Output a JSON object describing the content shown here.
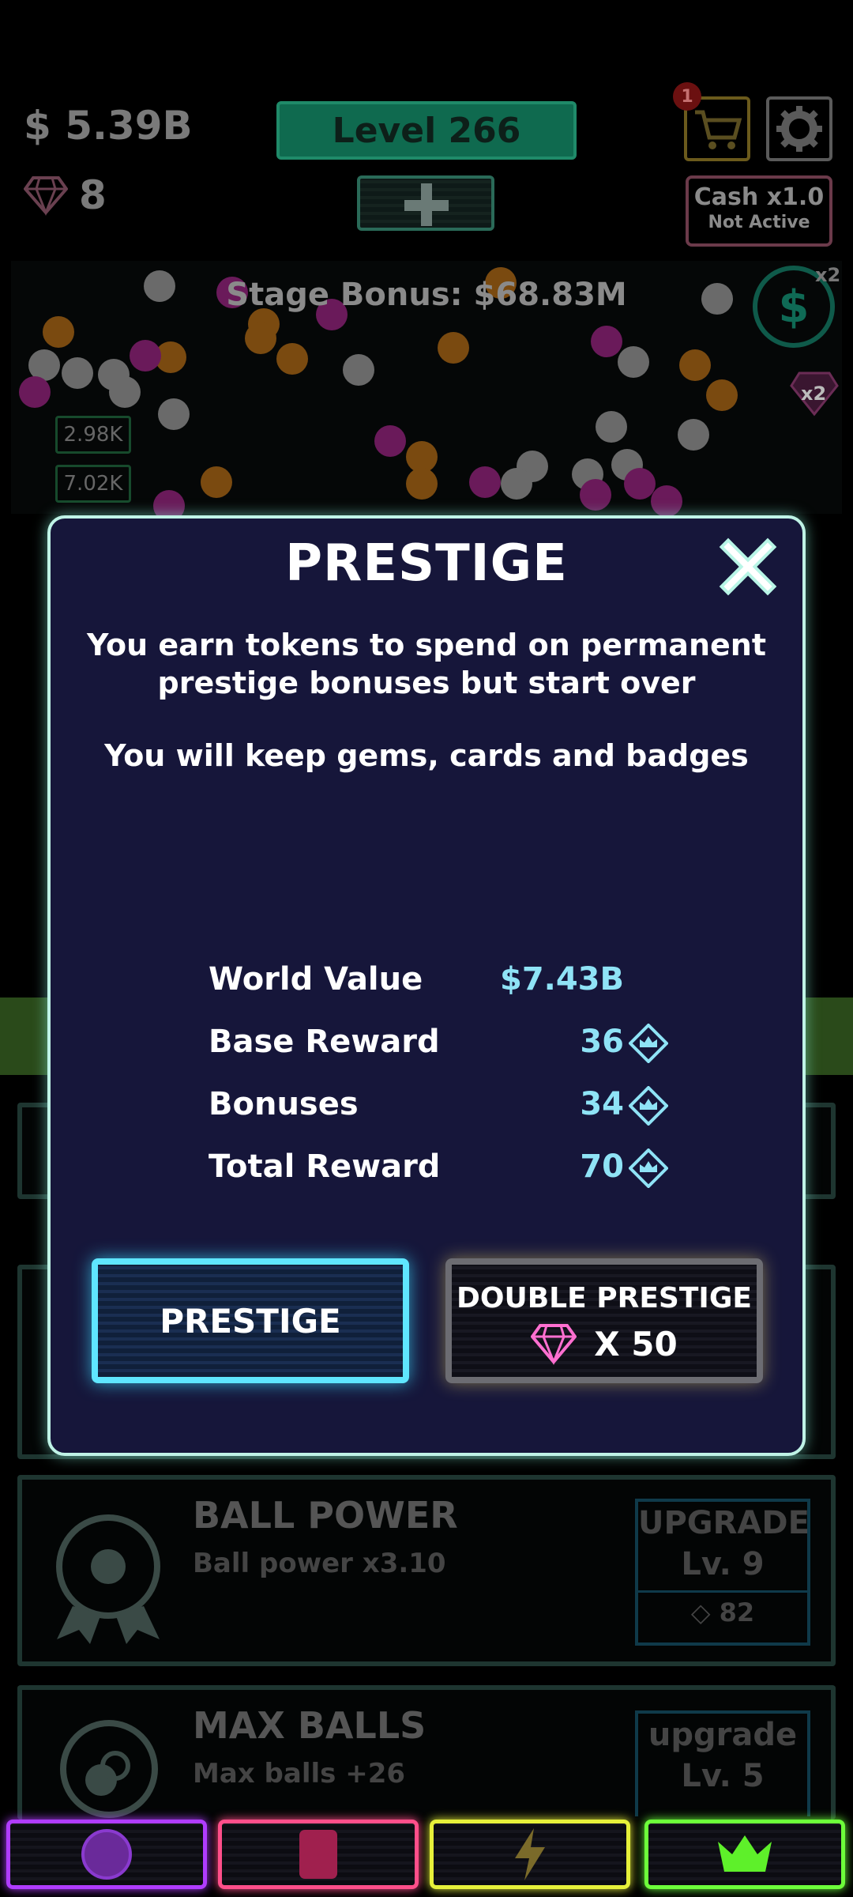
{
  "hud": {
    "money": "$ 5.39B",
    "gems": "8",
    "level": "Level 266",
    "cart_badge": "1",
    "cash_multiplier": "Cash x1.0",
    "cash_status": "Not Active"
  },
  "playfield": {
    "stage_bonus": "Stage Bonus: $68.83M",
    "dollar_symbol": "$",
    "dollar_multiplier": "x2",
    "gem_multiplier": "x2",
    "value_tags": [
      "2.98K",
      "7.02K"
    ]
  },
  "modal": {
    "title": "PRESTIGE",
    "description": "You earn tokens to spend on permanent prestige bonuses but start over",
    "keep_note": "You will keep gems, cards and badges",
    "stats": [
      {
        "label": "World Value",
        "value": "$7.43B",
        "has_token": false
      },
      {
        "label": "Base Reward",
        "value": "36",
        "has_token": true
      },
      {
        "label": "Bonuses",
        "value": "34",
        "has_token": true
      },
      {
        "label": "Total Reward",
        "value": "70",
        "has_token": true
      }
    ],
    "prestige_button": "PRESTIGE",
    "double_prestige_label": "DOUBLE PRESTIGE",
    "double_prestige_cost": "X 50"
  },
  "background_upgrades": [
    {
      "title": "BALL POWER",
      "subtitle": "Ball power x3.10",
      "action": "UPGRADE",
      "level": "Lv. 9",
      "cost": "82"
    },
    {
      "title": "MAX BALLS",
      "subtitle": "Max balls +26",
      "action": "upgrade",
      "level": "Lv. 5"
    }
  ],
  "nav": [
    {
      "name": "balls",
      "icon": "circle-icon",
      "color": "#b03cff"
    },
    {
      "name": "cards",
      "icon": "card-icon",
      "color": "#ff4f8a"
    },
    {
      "name": "boosts",
      "icon": "lightning-icon",
      "color": "#e6f03a"
    },
    {
      "name": "prestige",
      "icon": "crown-icon",
      "color": "#6dff3a"
    }
  ],
  "colors": {
    "modal_bg": "#16163a",
    "modal_border": "#bff3e6",
    "stat_value": "#8fe3f6",
    "prestige_glow": "#5fe6ff",
    "double_glow": "#f0d84a"
  }
}
